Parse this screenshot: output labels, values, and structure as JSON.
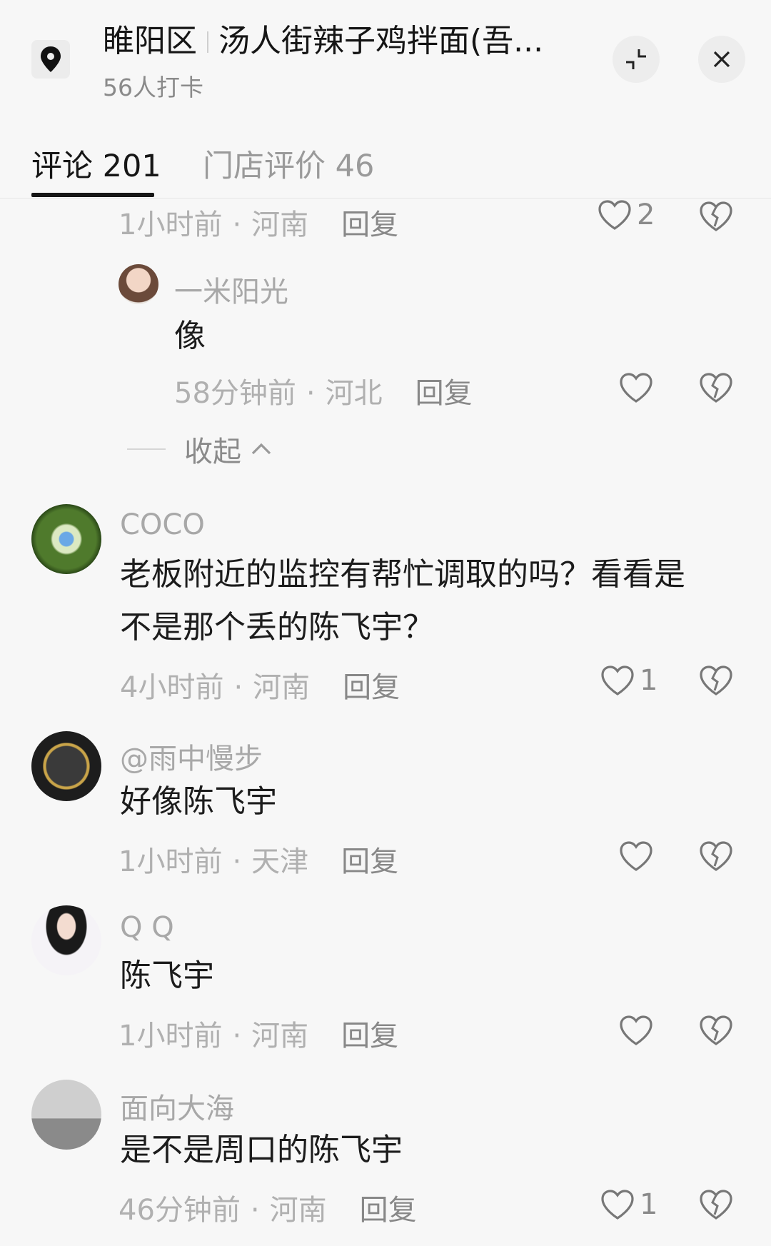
{
  "header": {
    "location_district": "睢阳区",
    "location_name": "汤人街辣子鸡拌面(吾...",
    "checkins": "56人打卡"
  },
  "tabs": [
    {
      "label": "评论 201"
    },
    {
      "label": "门店评价 46"
    }
  ],
  "collapse_label": "收起",
  "comments": [
    {
      "user": "",
      "text": "",
      "time": "1小时前",
      "region": "河南",
      "reply": "回复",
      "likes": "2"
    },
    {
      "user": "一米阳光",
      "text": "像",
      "time": "58分钟前",
      "region": "河北",
      "reply": "回复",
      "likes": ""
    },
    {
      "user": "COCO",
      "text_line1": "老板附近的监控有帮忙调取的吗？看看是",
      "text_line2": "不是那个丢的陈飞宇？",
      "time": "4小时前",
      "region": "河南",
      "reply": "回复",
      "likes": "1"
    },
    {
      "user": "@雨中慢步",
      "text": "好像陈飞宇",
      "time": "1小时前",
      "region": "天津",
      "reply": "回复",
      "likes": ""
    },
    {
      "user": "Q Q",
      "text": "陈飞宇",
      "time": "1小时前",
      "region": "河南",
      "reply": "回复",
      "likes": ""
    },
    {
      "user": "面向大海",
      "text": "是不是周口的陈飞宇",
      "time": "46分钟前",
      "region": "河南",
      "reply": "回复",
      "likes": "1"
    }
  ],
  "separator_dot": "·",
  "colors": {
    "background": "#f7f7f7",
    "text": "#1c1c1c",
    "muted": "#b0b0b0",
    "accent": "#161616"
  }
}
